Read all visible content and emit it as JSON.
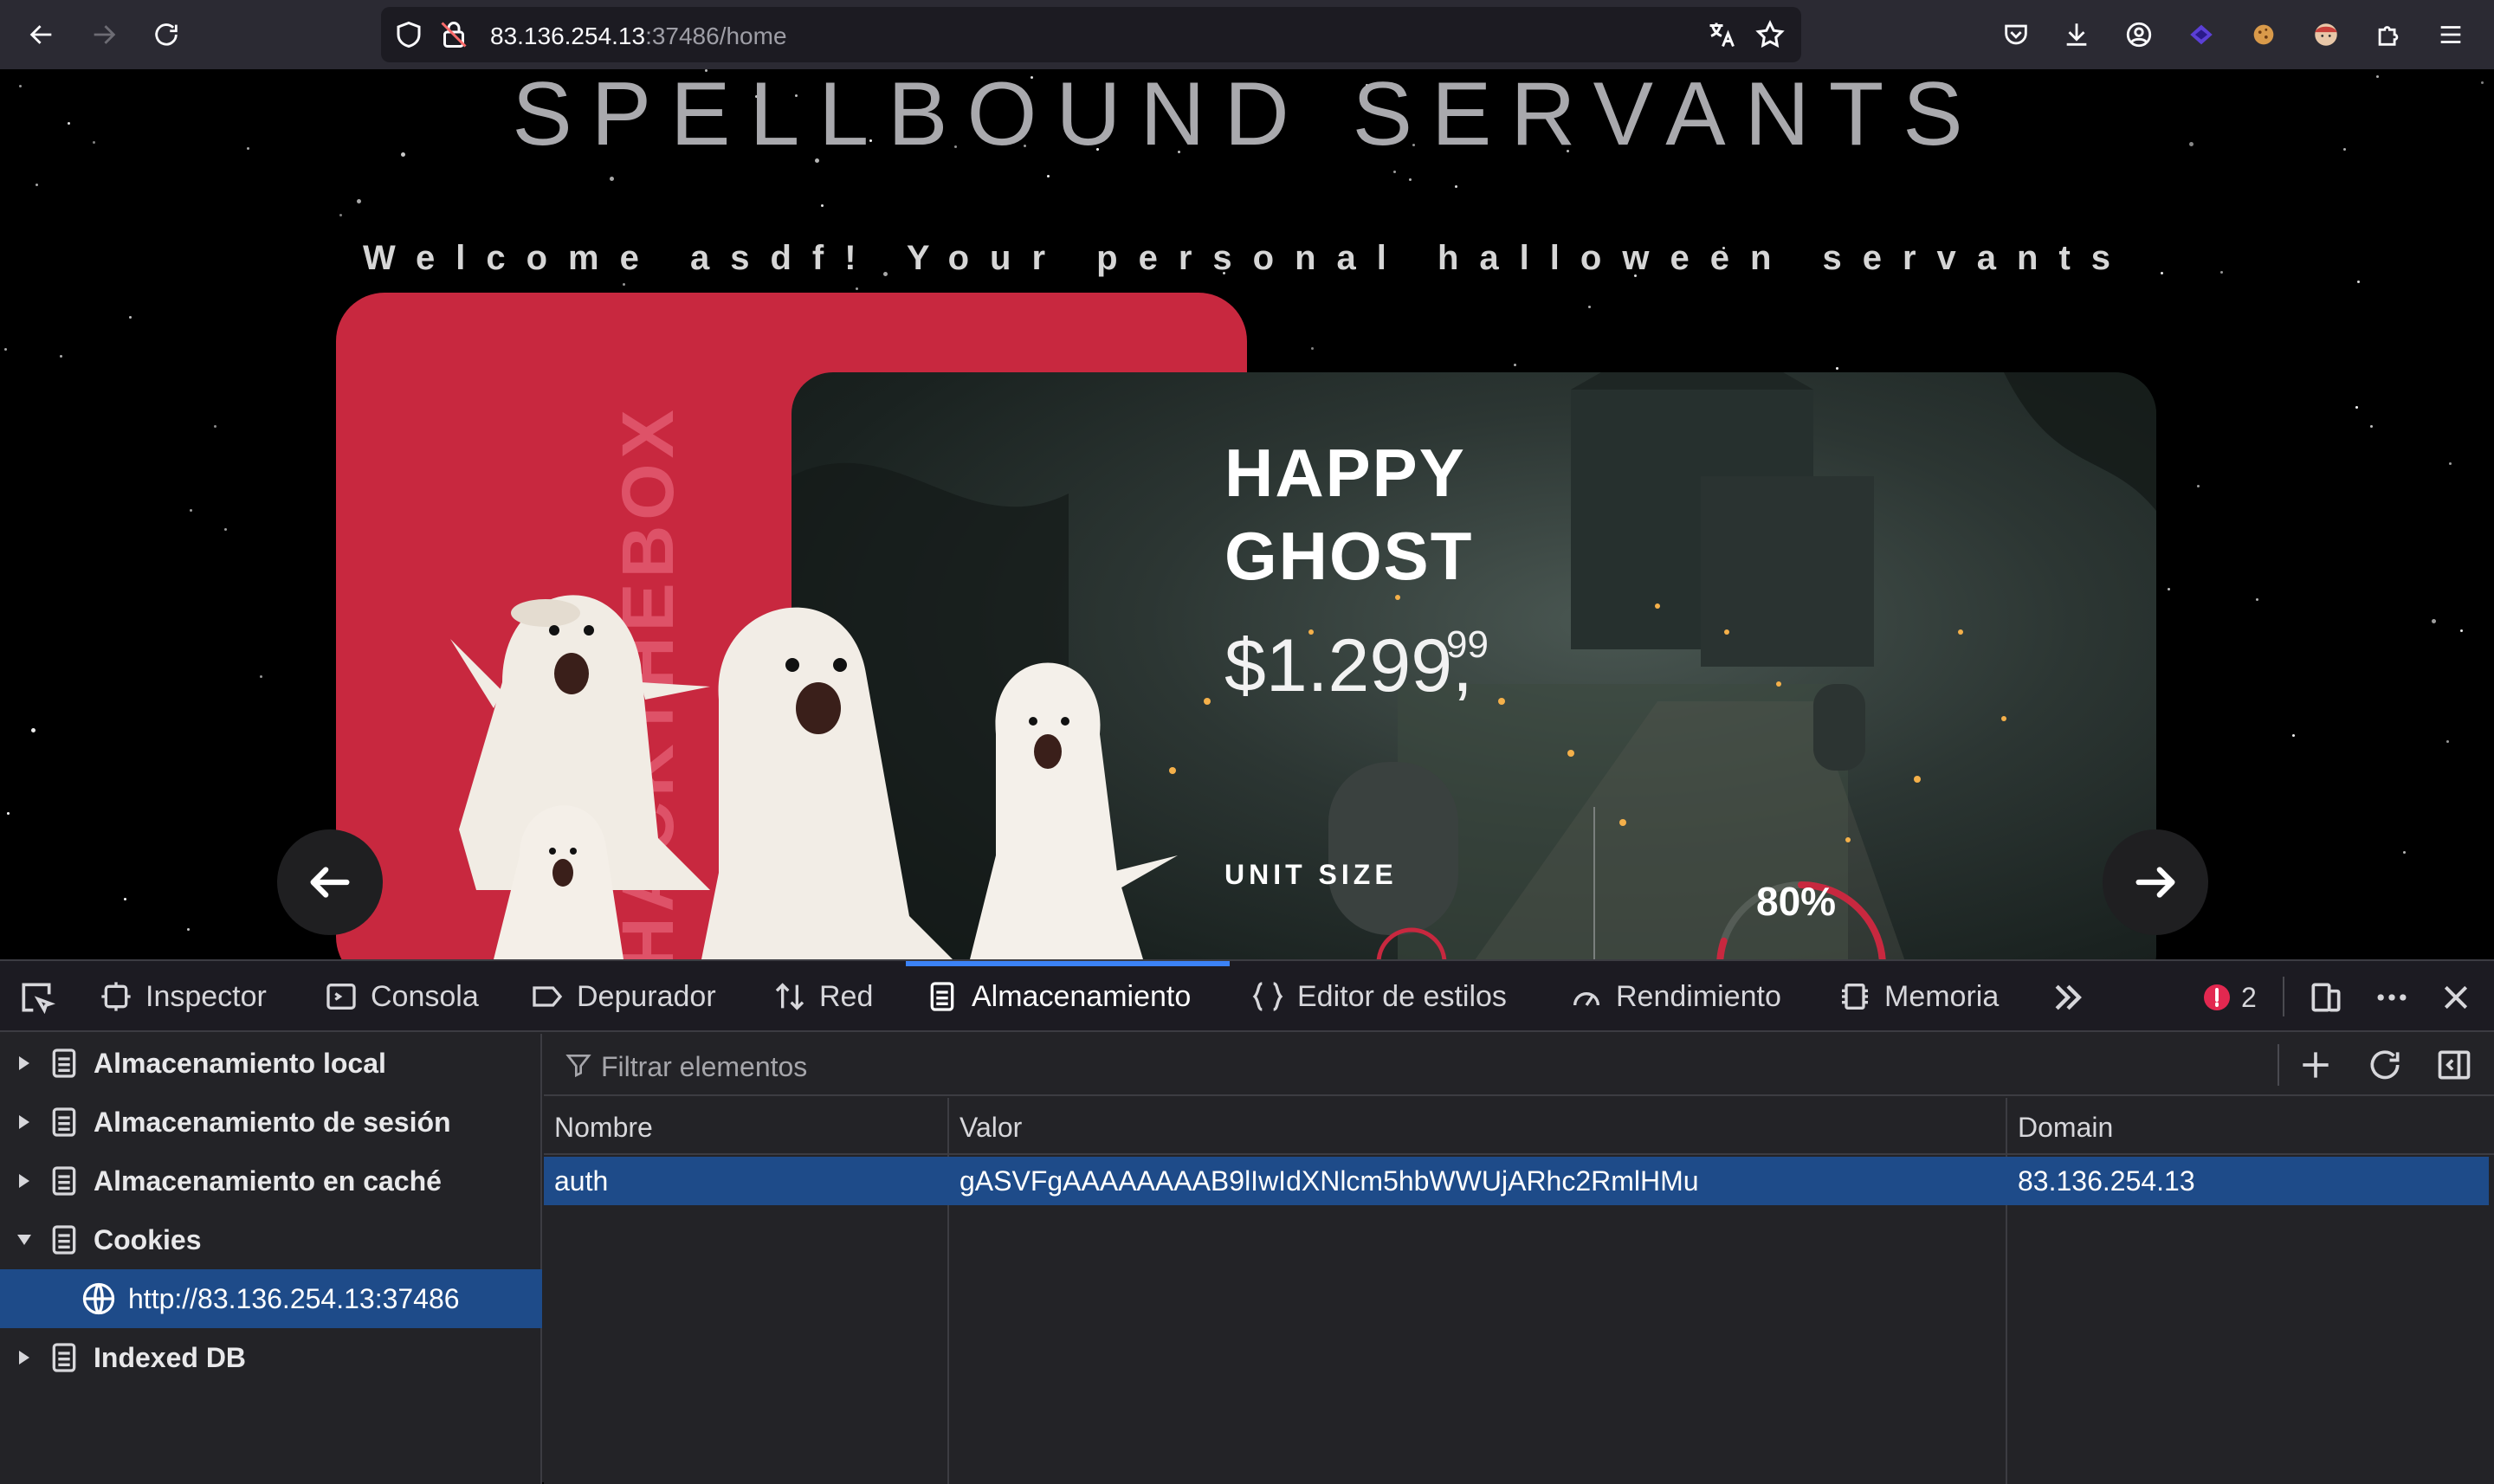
{
  "browser": {
    "url_host": "83.136.254.13",
    "url_rest": ":37486/home"
  },
  "page": {
    "title": "SPELLBOUND SERVANTS",
    "welcome": "Welcome asdf! Your personal halloween servants",
    "card_vertical_text": "HACKTHEBOX",
    "product": {
      "name_line1": "HAPPY",
      "name_line2": "GHOST",
      "price": "$1.299,",
      "cents": "99",
      "unit_size_label": "UNIT SIZE",
      "percent": "80%",
      "percent_value": 80
    }
  },
  "devtools": {
    "tabs": [
      {
        "label": "Inspector",
        "icon": "inspector-icon"
      },
      {
        "label": "Consola",
        "icon": "console-icon"
      },
      {
        "label": "Depurador",
        "icon": "debugger-icon"
      },
      {
        "label": "Red",
        "icon": "network-icon"
      },
      {
        "label": "Almacenamiento",
        "icon": "storage-icon"
      },
      {
        "label": "Editor de estilos",
        "icon": "style-editor-icon"
      },
      {
        "label": "Rendimiento",
        "icon": "performance-icon"
      },
      {
        "label": "Memoria",
        "icon": "memory-icon"
      }
    ],
    "error_count": "2",
    "sidebar": [
      {
        "label": "Almacenamiento local",
        "expanded": false
      },
      {
        "label": "Almacenamiento de sesión",
        "expanded": false
      },
      {
        "label": "Almacenamiento en caché",
        "expanded": false
      },
      {
        "label": "Cookies",
        "expanded": true
      },
      {
        "label": "http://83.136.254.13:37486",
        "selected": true
      },
      {
        "label": "Indexed DB",
        "expanded": false
      }
    ],
    "filter_placeholder": "Filtrar elementos",
    "table": {
      "columns": [
        "Nombre",
        "Valor",
        "Domain"
      ],
      "rows": [
        [
          "auth",
          "gASVFgAAAAAAAAB9lIwIdXNlcm5hbWWUjARhc2RmlHMu",
          "83.136.254.13"
        ]
      ]
    }
  }
}
